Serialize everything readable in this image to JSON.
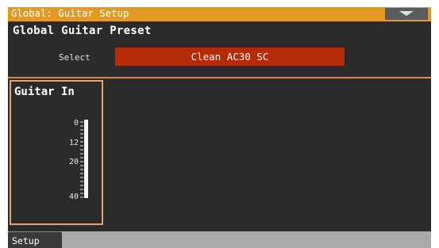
{
  "window": {
    "title": "Global: Guitar Setup",
    "menu_icon": "triangle-down-icon"
  },
  "preset": {
    "section_title": "Global Guitar Preset",
    "select_label": "Select",
    "select_value": "Clean AC30 SC"
  },
  "guitar_in": {
    "title": "Guitar In",
    "scale_labels": [
      "0",
      "12",
      "20",
      "40"
    ]
  },
  "tabs": [
    {
      "label": "Setup",
      "active": true
    }
  ],
  "colors": {
    "accent_orange": "#e39a1f",
    "select_red": "#b52a07",
    "panel_border": "#f0a070",
    "background": "#2b2b2b"
  }
}
